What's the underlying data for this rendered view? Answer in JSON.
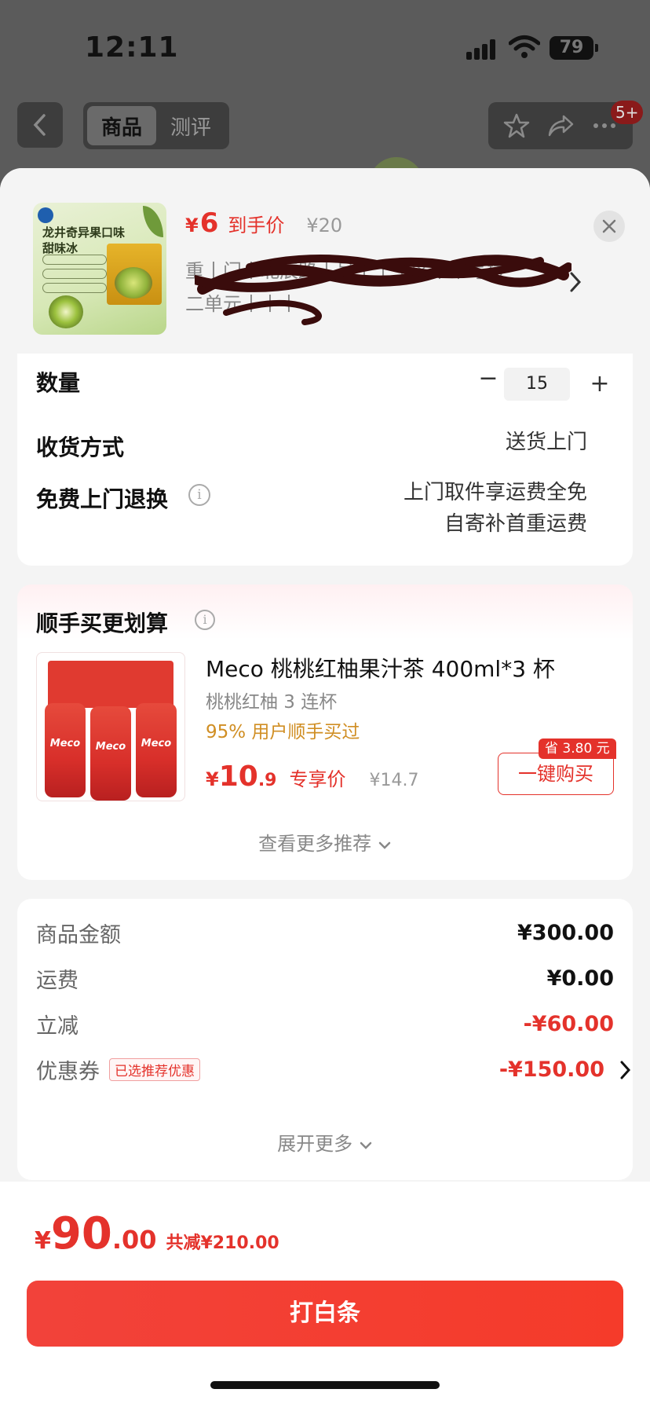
{
  "status_bar": {
    "time": "12:11",
    "battery": "79"
  },
  "nav": {
    "tabs": [
      {
        "label": "商品"
      },
      {
        "label": "测评"
      }
    ],
    "badge": "5+"
  },
  "product": {
    "thumb_title": "龙井奇异果口味\n甜味冰",
    "price_currency": "¥",
    "price": "6",
    "price_tag": "到手价",
    "original_price": "¥20",
    "address_partial": "重…………………………………………号楼\n二单…………………"
  },
  "options": {
    "quantity_label": "数量",
    "quantity_value": "15",
    "minus": "−",
    "plus": "+",
    "delivery_label": "收货方式",
    "delivery_value": "送货上门",
    "return_label": "免费上门退换",
    "return_value_1": "上门取件享运费全免",
    "return_value_2": "自寄补首重运费"
  },
  "upsell": {
    "title": "顺手买更划算",
    "name": "Meco 桃桃红柚果汁茶 400ml*3 杯",
    "subtitle": "桃桃红柚 3 连杯",
    "percent": "95% 用户顺手买过",
    "price_currency": "¥",
    "price_int": "10",
    "price_dec": ".9",
    "price_tag": "专享价",
    "original_price": "¥14.7",
    "save_badge": "省 3.80 元",
    "buy_button": "一键购买",
    "more": "查看更多推荐",
    "can_label": "Meco"
  },
  "summary": {
    "rows": [
      {
        "label": "商品金额",
        "value": "¥300.00",
        "red": false
      },
      {
        "label": "运费",
        "value": "¥0.00",
        "red": false
      },
      {
        "label": "立减",
        "value": "-¥60.00",
        "red": true
      },
      {
        "label": "优惠券",
        "value": "-¥150.00",
        "red": true,
        "tag": "已选推荐优惠"
      }
    ],
    "expand": "展开更多"
  },
  "footer": {
    "currency": "¥",
    "total_int": "90",
    "total_dec": ".00",
    "save": "共减¥210.00",
    "pay_button": "打白条"
  },
  "colors": {
    "accent": "#e4322b",
    "pay_button": "#f53b2a",
    "orange": "#d08e23"
  }
}
